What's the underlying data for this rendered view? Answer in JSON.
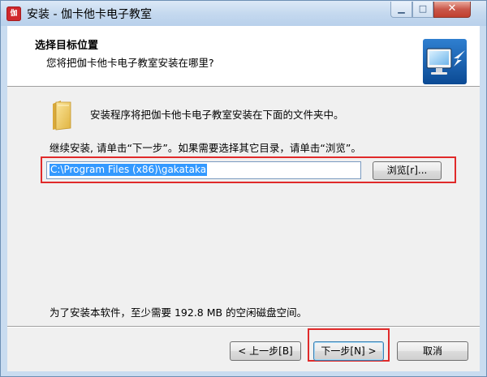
{
  "window": {
    "title": "安装 - 伽卡他卡电子教室",
    "app_icon_text": "伽",
    "minimize_glyph": "▁",
    "maximize_glyph": "□",
    "close_glyph": "✕"
  },
  "header": {
    "title": "选择目标位置",
    "subtitle": "您将把伽卡他卡电子教室安装在哪里?"
  },
  "body": {
    "info_text": "安装程序将把伽卡他卡电子教室安装在下面的文件夹中。",
    "continue_text": "继续安装, 请单击“下一步”。如果需要选择其它目录，请单击“浏览”。",
    "path_value": "C:\\Program Files (x86)\\gakataka",
    "browse_label": "浏览[r]...",
    "space_text": "为了安装本软件，至少需要 192.8 MB 的空闲磁盘空间。"
  },
  "footer": {
    "back_label": "< 上一步[B]",
    "next_label": "下一步[N] >",
    "cancel_label": "取消"
  },
  "colors": {
    "highlight": "#e02a2a",
    "selection": "#3399ff",
    "titlebar": "#c5d9ef"
  },
  "icons": [
    "app-icon",
    "folder-icon",
    "computer-install-icon"
  ]
}
